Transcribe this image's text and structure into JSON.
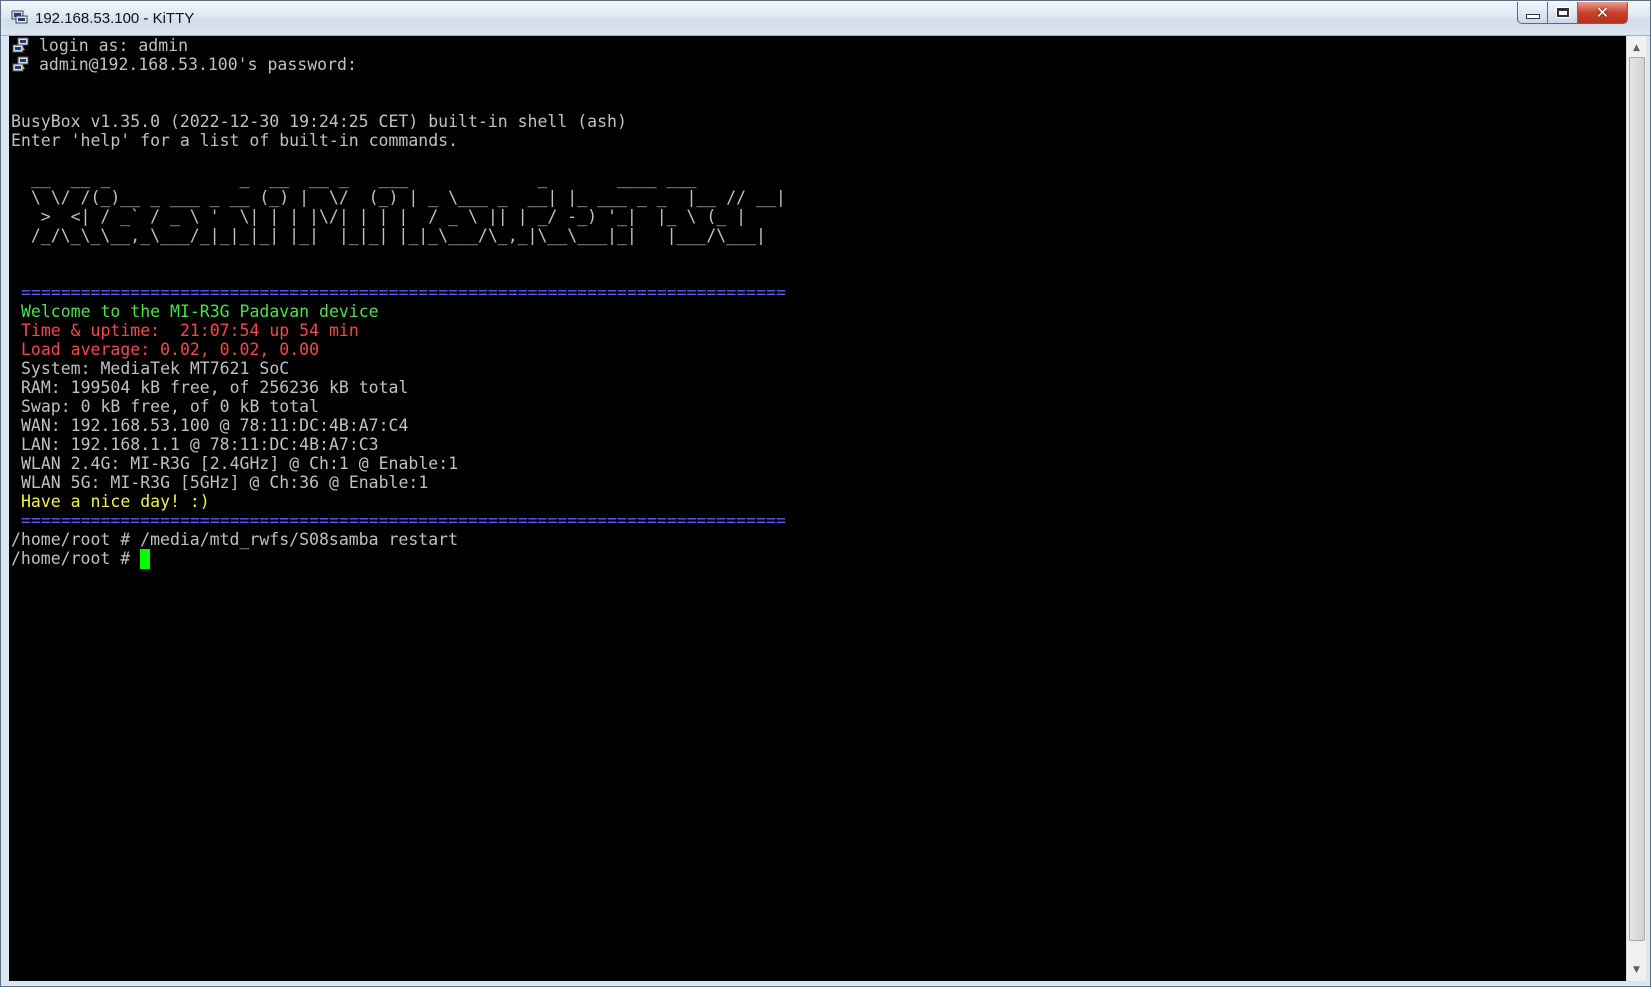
{
  "window": {
    "title": "192.168.53.100 - KiTTY",
    "controls": {
      "minimize": "minimize",
      "maximize": "maximize",
      "close": "✕"
    }
  },
  "terminal": {
    "login_prompt": "login as: admin",
    "password_prompt": "admin@192.168.53.100's password:",
    "busybox_line": "BusyBox v1.35.0 (2022-12-30 19:24:25 CET) built-in shell (ash)",
    "help_line": "Enter 'help' for a list of built-in commands.",
    "ascii_art": [
      "  __  __ _             _  __  __ _   ___             _       ____ ___",
      "  \\ \\/ /(_)__ _ ___ _ __ (_) |  \\/  (_) | _ \\___ _  __| |_ ___ _ _  |__ // __|",
      "   >  <| / _` / _ \\ '  \\| | | |\\/| | | |  / _ \\ || | _/ -_) '_|  |_ \\ (_ |",
      "  /_/\\_\\_\\__,_\\___/_|_|_|_| |_|  |_|_| |_|_\\___/\\_,_|\\__\\___|_|   |___/\\___|"
    ],
    "separator": "=============================================================================",
    "welcome": "Welcome to the MI-R3G Padavan device",
    "uptime": "Time & uptime:  21:07:54 up 54 min",
    "load": "Load average: 0.02, 0.02, 0.00",
    "system": "System: MediaTek MT7621 SoC",
    "ram": "RAM: 199504 kB free, of 256236 kB total",
    "swap": "Swap: 0 kB free, of 0 kB total",
    "wan": "WAN: 192.168.53.100 @ 78:11:DC:4B:A7:C4",
    "lan": "LAN: 192.168.1.1 @ 78:11:DC:4B:A7:C3",
    "wlan24": "WLAN 2.4G: MI-R3G [2.4GHz] @ Ch:1 @ Enable:1",
    "wlan5": "WLAN 5G: MI-R3G [5GHz] @ Ch:36 @ Enable:1",
    "nice_day": "Have a nice day! :)",
    "command_line": "/home/root # /media/mtd_rwfs/S08samba restart",
    "prompt_line": "/home/root # "
  },
  "colors": {
    "background": "#000000",
    "default_text": "#c0c0c0",
    "green": "#4ce04c",
    "red": "#f04a4a",
    "yellow": "#f2f24a",
    "blue": "#5a5aff",
    "cursor": "#00ff00"
  },
  "icons": {
    "app": "kitty-terminal-icon",
    "prompt": "putty-computers-icon"
  }
}
